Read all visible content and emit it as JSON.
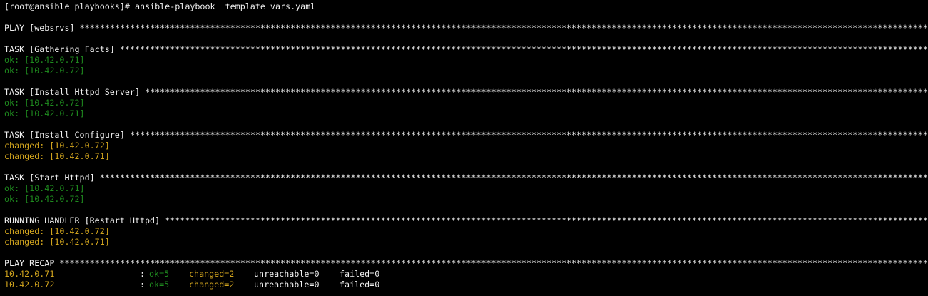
{
  "colors": {
    "background": "#000000",
    "text": "#f0f0f0",
    "ok": "#1f8a1f",
    "changed": "#d2a51e"
  },
  "prompt": "[root@ansible playbooks]# ansible-playbook  template_vars.yaml",
  "stars": "*****************************************************************************************************************************************************************************************************************************************************************",
  "play_header": "PLAY [websrvs]",
  "sections": [
    {
      "header": "TASK [Gathering Facts]",
      "lines": [
        {
          "status": "ok",
          "text": "ok: [10.42.0.71]"
        },
        {
          "status": "ok",
          "text": "ok: [10.42.0.72]"
        }
      ]
    },
    {
      "header": "TASK [Install Httpd Server]",
      "lines": [
        {
          "status": "ok",
          "text": "ok: [10.42.0.72]"
        },
        {
          "status": "ok",
          "text": "ok: [10.42.0.71]"
        }
      ]
    },
    {
      "header": "TASK [Install Configure]",
      "lines": [
        {
          "status": "changed",
          "text": "changed: [10.42.0.72]"
        },
        {
          "status": "changed",
          "text": "changed: [10.42.0.71]"
        }
      ]
    },
    {
      "header": "TASK [Start Httpd]",
      "lines": [
        {
          "status": "ok",
          "text": "ok: [10.42.0.71]"
        },
        {
          "status": "ok",
          "text": "ok: [10.42.0.72]"
        }
      ]
    },
    {
      "header": "RUNNING HANDLER [Restart_Httpd]",
      "lines": [
        {
          "status": "changed",
          "text": "changed: [10.42.0.72]"
        },
        {
          "status": "changed",
          "text": "changed: [10.42.0.71]"
        }
      ]
    }
  ],
  "recap": {
    "header": "PLAY RECAP",
    "rows": [
      {
        "host": "10.42.0.71",
        "colon": ":",
        "ok": "ok=5",
        "changed": "changed=2",
        "unreachable": "unreachable=0",
        "failed": "failed=0"
      },
      {
        "host": "10.42.0.72",
        "colon": ":",
        "ok": "ok=5",
        "changed": "changed=2",
        "unreachable": "unreachable=0",
        "failed": "failed=0"
      }
    ]
  }
}
